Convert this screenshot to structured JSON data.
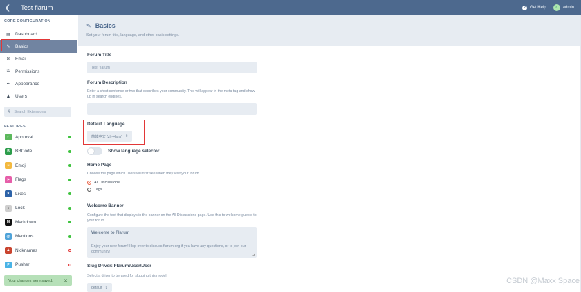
{
  "header": {
    "title": "Test flarum",
    "back_icon": "chevron-left-icon",
    "help_label": "Get Help",
    "user_name": "admin",
    "avatar_letter": "a"
  },
  "sidebar": {
    "core_title": "CORE CONFIGURATION",
    "core_items": [
      {
        "label": "Dashboard",
        "icon": "chart-icon"
      },
      {
        "label": "Basics",
        "icon": "pencil-icon"
      },
      {
        "label": "Email",
        "icon": "envelope-icon"
      },
      {
        "label": "Permissions",
        "icon": "key-icon"
      },
      {
        "label": "Appearance",
        "icon": "paintbrush-icon"
      },
      {
        "label": "Users",
        "icon": "users-icon"
      }
    ],
    "search_placeholder": "Search Extensions",
    "features_title": "FEATURES",
    "extensions": [
      {
        "label": "Approval",
        "color": "#5cb85c",
        "enabled": true
      },
      {
        "label": "BBCode",
        "color": "#2c9d4b",
        "enabled": true
      },
      {
        "label": "Emoji",
        "color": "#f3b93f",
        "enabled": true
      },
      {
        "label": "Flags",
        "color": "#e65ea9",
        "enabled": true
      },
      {
        "label": "Likes",
        "color": "#2d63a8",
        "enabled": true
      },
      {
        "label": "Lock",
        "color": "#cfcfcf",
        "enabled": true
      },
      {
        "label": "Markdown",
        "color": "#111111",
        "enabled": true
      },
      {
        "label": "Mentions",
        "color": "#4fa3d9",
        "enabled": true
      },
      {
        "label": "Nicknames",
        "color": "#c9442f",
        "enabled": false
      },
      {
        "label": "Pusher",
        "color": "#49b3e6",
        "enabled": false
      }
    ]
  },
  "main": {
    "title": "Basics",
    "subtitle": "Set your forum title, language, and other basic settings.",
    "forum_title_label": "Forum Title",
    "forum_title_value": "Test flarum",
    "forum_description_label": "Forum Description",
    "forum_description_help": "Enter a short sentence or two that describes your community. This will appear in the meta tag and show up in search engines.",
    "default_language_label": "Default Language",
    "default_language_value": "简体中文 (zh-Hans)",
    "show_language_selector_label": "Show language selector",
    "home_page_label": "Home Page",
    "home_page_help": "Choose the page which users will first see when they visit your forum.",
    "home_options": [
      "All Discussions",
      "Tags"
    ],
    "welcome_banner_label": "Welcome Banner",
    "welcome_banner_help": "Configure the text that displays in the banner on the All Discussions page. Use this to welcome guests to your forum.",
    "welcome_title": "Welcome to Flarum",
    "welcome_text": "Enjoy your new forum! Hop over to discuss.flarum.org if you have any questions, or to join our community!",
    "slug_driver_label": "Slug Driver: Flarum\\User\\User",
    "slug_driver_help": "Select a driver to be used for slugging this model.",
    "slug_driver_value": "default"
  },
  "toast": {
    "message": "Your changes were saved."
  },
  "watermark": "CSDN @Maxx Space"
}
